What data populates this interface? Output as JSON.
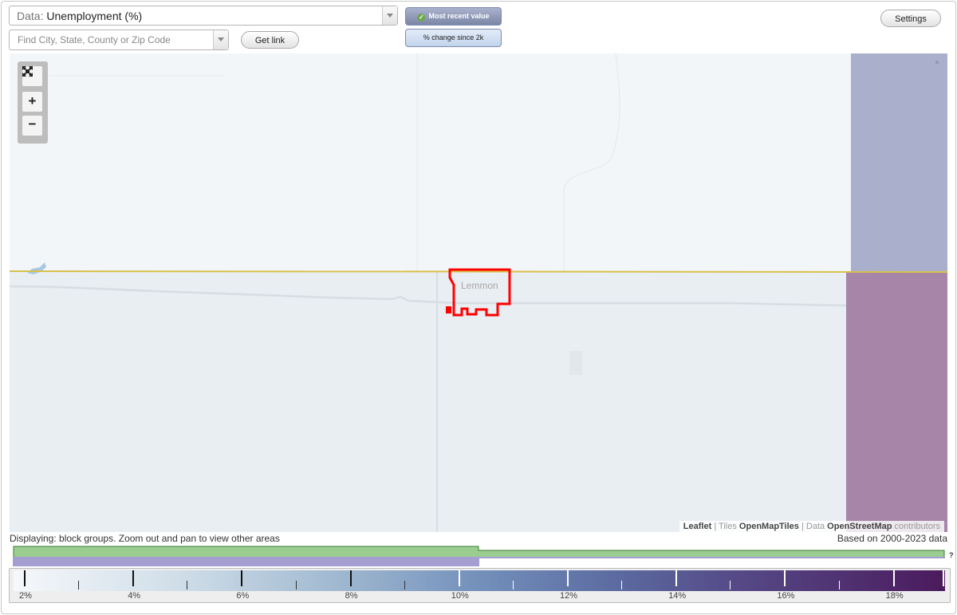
{
  "data_select": {
    "prefix": "Data:",
    "value": "Unemployment (%)"
  },
  "search": {
    "placeholder": "Find City, State, County or Zip Code"
  },
  "get_link_label": "Get link",
  "settings_label": "Settings",
  "modes": {
    "recent": "Most recent value",
    "change": "% change since 2k"
  },
  "map": {
    "city": "Lemmon",
    "attribution": {
      "leaflet": "Leaflet",
      "sep1": " | Tiles ",
      "tiles": "OpenMapTiles",
      "sep2": " | Data ",
      "osm": "OpenStreetMap",
      "contrib": " contributors"
    }
  },
  "status": {
    "displaying": "Displaying: block groups. Zoom out and pan to view other areas",
    "based_on": "Based on 2000-2023 data",
    "help": "?"
  },
  "legend": {
    "labels": [
      "2%",
      "4%",
      "6%",
      "8%",
      "10%",
      "12%",
      "14%",
      "16%",
      "18%"
    ]
  },
  "colors": {
    "accent": "#7b86a6",
    "outline": "#ff0000",
    "state_line": "#e0c84a",
    "region_right_top": "#aab0cc",
    "region_right_bottom": "#a685a8"
  }
}
